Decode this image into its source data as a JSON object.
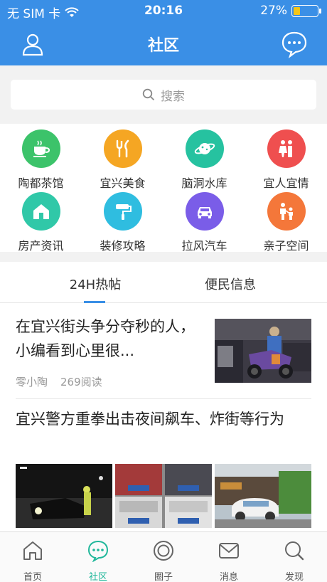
{
  "status_bar": {
    "carrier": "无 SIM 卡",
    "time": "20:16",
    "battery": "27%",
    "battery_level": 0.27
  },
  "header": {
    "title": "社区",
    "left_icon": "user-icon",
    "right_icon": "chat-bubble-icon"
  },
  "search": {
    "placeholder": "搜索"
  },
  "categories": [
    {
      "label": "陶都茶馆",
      "icon": "teacup-icon",
      "color": "#3cc36a"
    },
    {
      "label": "宜兴美食",
      "icon": "fork-knife-icon",
      "color": "#f5a623"
    },
    {
      "label": "脑洞水库",
      "icon": "planet-icon",
      "color": "#26c2a0"
    },
    {
      "label": "宜人宜情",
      "icon": "couple-icon",
      "color": "#ef4f4f"
    },
    {
      "label": "房产资讯",
      "icon": "house-icon",
      "color": "#30c8a8"
    },
    {
      "label": "装修攻略",
      "icon": "paint-roller-icon",
      "color": "#2fbde0"
    },
    {
      "label": "拉风汽车",
      "icon": "car-icon",
      "color": "#7a5de8"
    },
    {
      "label": "亲子空间",
      "icon": "parent-child-icon",
      "color": "#f4773a"
    }
  ],
  "tabs": [
    {
      "label": "24H热帖",
      "active": true
    },
    {
      "label": "便民信息",
      "active": false
    }
  ],
  "posts": [
    {
      "title": "在宜兴街头争分夺秒的人，小编看到心里很...",
      "author": "零小陶",
      "reads": "269阅读"
    },
    {
      "title": "宜兴警方重拳出击夜间飙车、炸街等行为"
    }
  ],
  "tabbar": [
    {
      "label": "首页",
      "icon": "home-icon",
      "active": false
    },
    {
      "label": "社区",
      "icon": "community-chat-icon",
      "active": true
    },
    {
      "label": "圈子",
      "icon": "circle-icon",
      "active": false
    },
    {
      "label": "消息",
      "icon": "mail-icon",
      "active": false
    },
    {
      "label": "发现",
      "icon": "search-icon",
      "active": false
    }
  ],
  "colors": {
    "primary": "#3a8fe6",
    "tab_active": "#1fb79a"
  }
}
